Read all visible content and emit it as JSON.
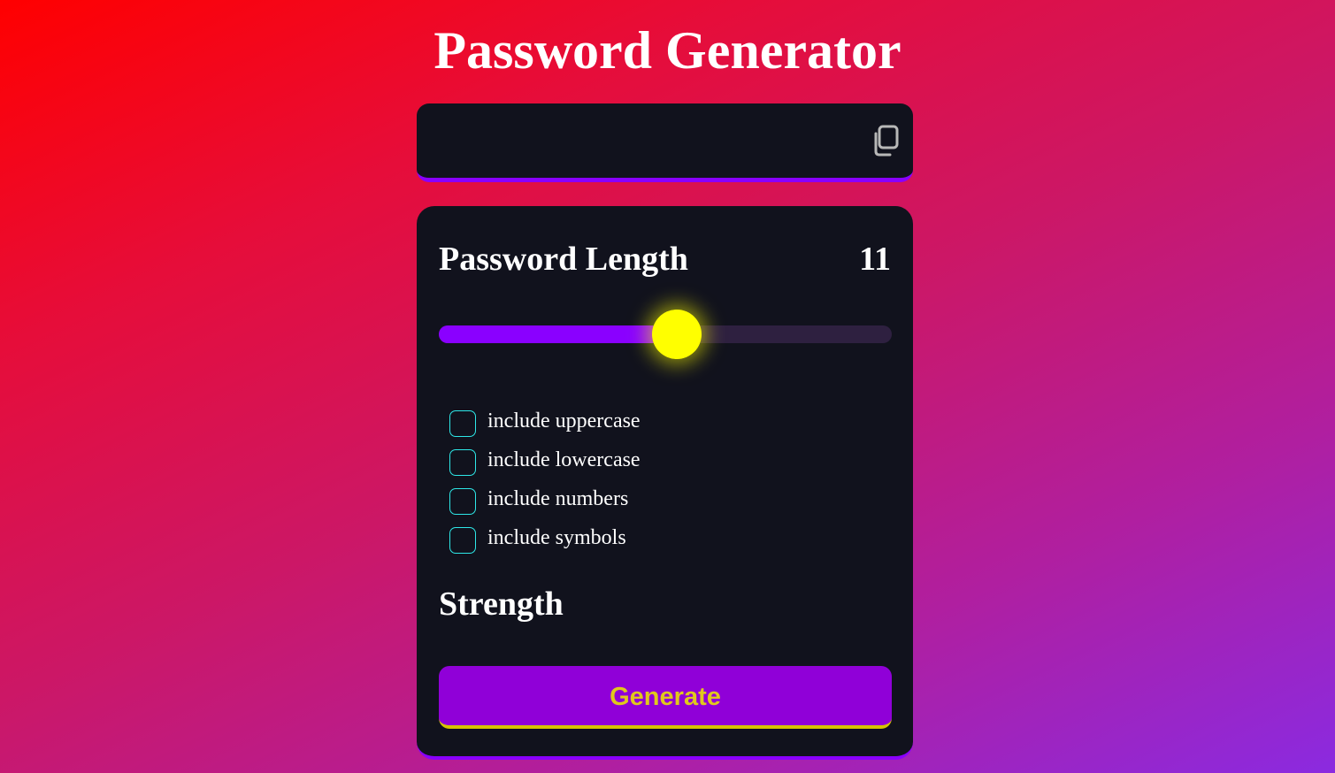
{
  "app": {
    "title": "Password Generator"
  },
  "display": {
    "password_value": "",
    "copy_icon": "copy-icon"
  },
  "length": {
    "label": "Password Length",
    "value": "11",
    "slider_fraction": 0.525
  },
  "options": [
    {
      "label": "include uppercase",
      "checked": false
    },
    {
      "label": "include lowercase",
      "checked": false
    },
    {
      "label": "include numbers",
      "checked": false
    },
    {
      "label": "include symbols",
      "checked": false
    }
  ],
  "strength": {
    "label": "Strength"
  },
  "actions": {
    "generate_label": "Generate"
  },
  "colors": {
    "accent": "#8a00ff",
    "thumb": "#ffff00",
    "checkbox_border": "#2ee8e8",
    "button_bg": "#9000d8",
    "button_text": "#e0c81c",
    "panel_bg": "#11121d"
  }
}
